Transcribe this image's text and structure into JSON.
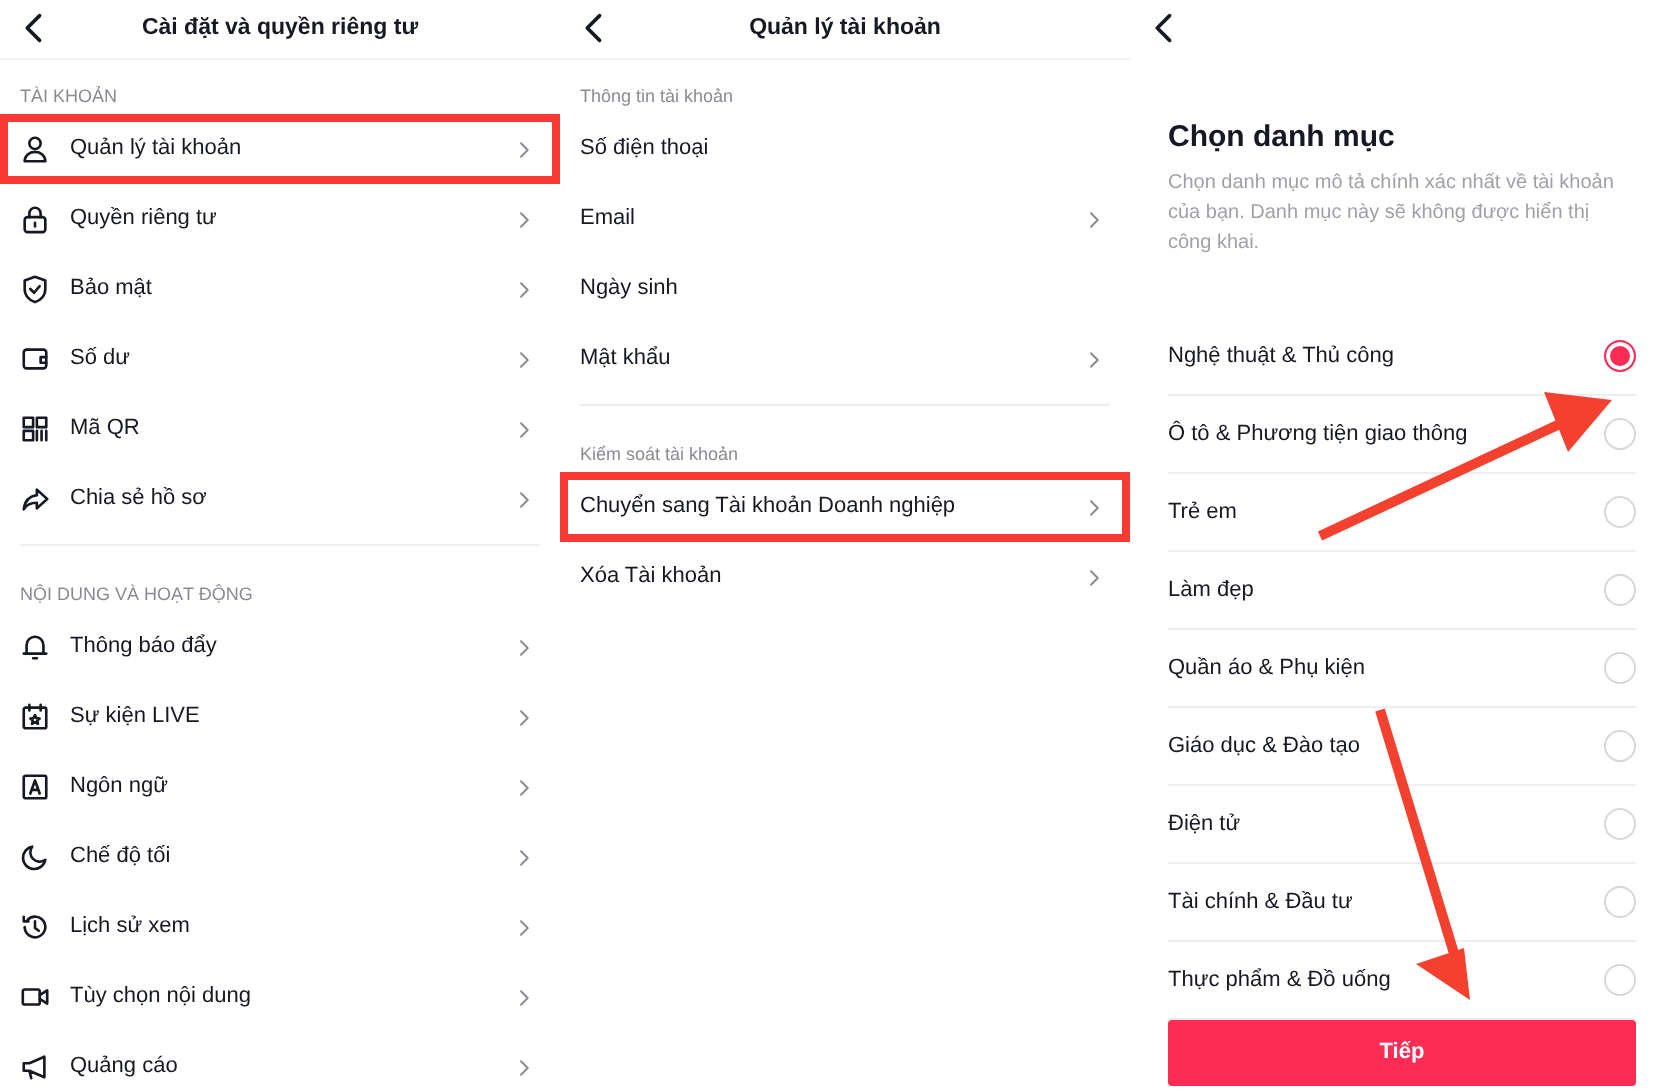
{
  "panels": [
    {
      "kind": "settings",
      "title": "Cài đặt và quyền riêng tư",
      "sections": [
        {
          "label": "TÀI KHOẢN",
          "items": [
            {
              "label": "Quản lý tài khoản",
              "highlighted": true,
              "chevron": true
            },
            {
              "label": "Quyền riêng tư",
              "highlighted": false,
              "chevron": true
            },
            {
              "label": "Bảo mật",
              "highlighted": false,
              "chevron": true
            },
            {
              "label": "Số dư",
              "highlighted": false,
              "chevron": true
            },
            {
              "label": "Mã QR",
              "highlighted": false,
              "chevron": true
            },
            {
              "label": "Chia sẻ hồ sơ",
              "highlighted": false,
              "chevron": true
            }
          ]
        },
        {
          "label": "NỘI DUNG VÀ HOẠT ĐỘNG",
          "items": [
            {
              "label": "Thông báo đẩy",
              "highlighted": false,
              "chevron": true
            },
            {
              "label": "Sự kiện LIVE",
              "highlighted": false,
              "chevron": true
            },
            {
              "label": "Ngôn ngữ",
              "highlighted": false,
              "chevron": true
            },
            {
              "label": "Chế độ tối",
              "highlighted": false,
              "chevron": true
            },
            {
              "label": "Lịch sử xem",
              "highlighted": false,
              "chevron": true
            },
            {
              "label": "Tùy chọn nội dung",
              "highlighted": false,
              "chevron": true
            },
            {
              "label": "Quảng cáo",
              "highlighted": false,
              "chevron": true
            }
          ]
        }
      ]
    },
    {
      "kind": "settings",
      "title": "Quản lý tài khoản",
      "sections": [
        {
          "label": "Thông tin tài khoản",
          "items": [
            {
              "label": "Số điện thoại",
              "highlighted": false,
              "chevron": false
            },
            {
              "label": "Email",
              "highlighted": false,
              "chevron": true
            },
            {
              "label": "Ngày sinh",
              "highlighted": false,
              "chevron": false
            },
            {
              "label": "Mật khẩu",
              "highlighted": false,
              "chevron": true
            }
          ]
        },
        {
          "label": "Kiểm soát tài khoản",
          "items": [
            {
              "label": "Chuyển sang Tài khoản Doanh nghiệp",
              "highlighted": true,
              "chevron": true
            },
            {
              "label": "Xóa Tài khoản",
              "highlighted": false,
              "chevron": true
            }
          ]
        }
      ]
    },
    {
      "kind": "category",
      "title": "Chọn danh mục",
      "description": "Chọn danh mục mô tả chính xác nhất về tài khoản của bạn. Danh mục này sẽ không được hiển thị công khai.",
      "options": [
        {
          "label": "Nghệ thuật & Thủ công",
          "selected": true
        },
        {
          "label": "Ô tô & Phương tiện giao thông",
          "selected": false
        },
        {
          "label": "Trẻ em",
          "selected": false
        },
        {
          "label": "Làm đẹp",
          "selected": false
        },
        {
          "label": "Quần áo & Phụ kiện",
          "selected": false
        },
        {
          "label": "Giáo dục & Đào tạo",
          "selected": false
        },
        {
          "label": "Điện tử",
          "selected": false
        },
        {
          "label": "Tài chính & Đầu tư",
          "selected": false
        },
        {
          "label": "Thực phẩm & Đồ uống",
          "selected": false
        }
      ],
      "button": "Tiếp"
    }
  ]
}
